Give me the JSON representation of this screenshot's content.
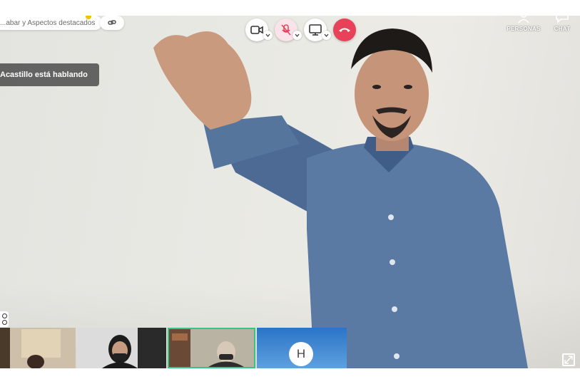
{
  "toolbar": {
    "record_label": "...abar y Aspectos destacados",
    "camera": "camera-icon",
    "mic": "mic-muted-icon",
    "screen": "screen-share-icon",
    "end_call": "hang-up-icon"
  },
  "right_actions": {
    "people_label": "PERSONAS",
    "chat_label": "CHAT"
  },
  "speaker": {
    "label": "Acastillo está hablando"
  },
  "thumbnails": [
    {
      "name": "participant-1"
    },
    {
      "name": "participant-2"
    },
    {
      "name": "participant-3"
    },
    {
      "name": "participant-4",
      "initial": "H"
    }
  ],
  "colors": {
    "end_call": "#e8415a",
    "active_speaker_border": "#35c483",
    "muted_bg": "#fbe3ea",
    "avatar_tile": "#2b74c7"
  }
}
